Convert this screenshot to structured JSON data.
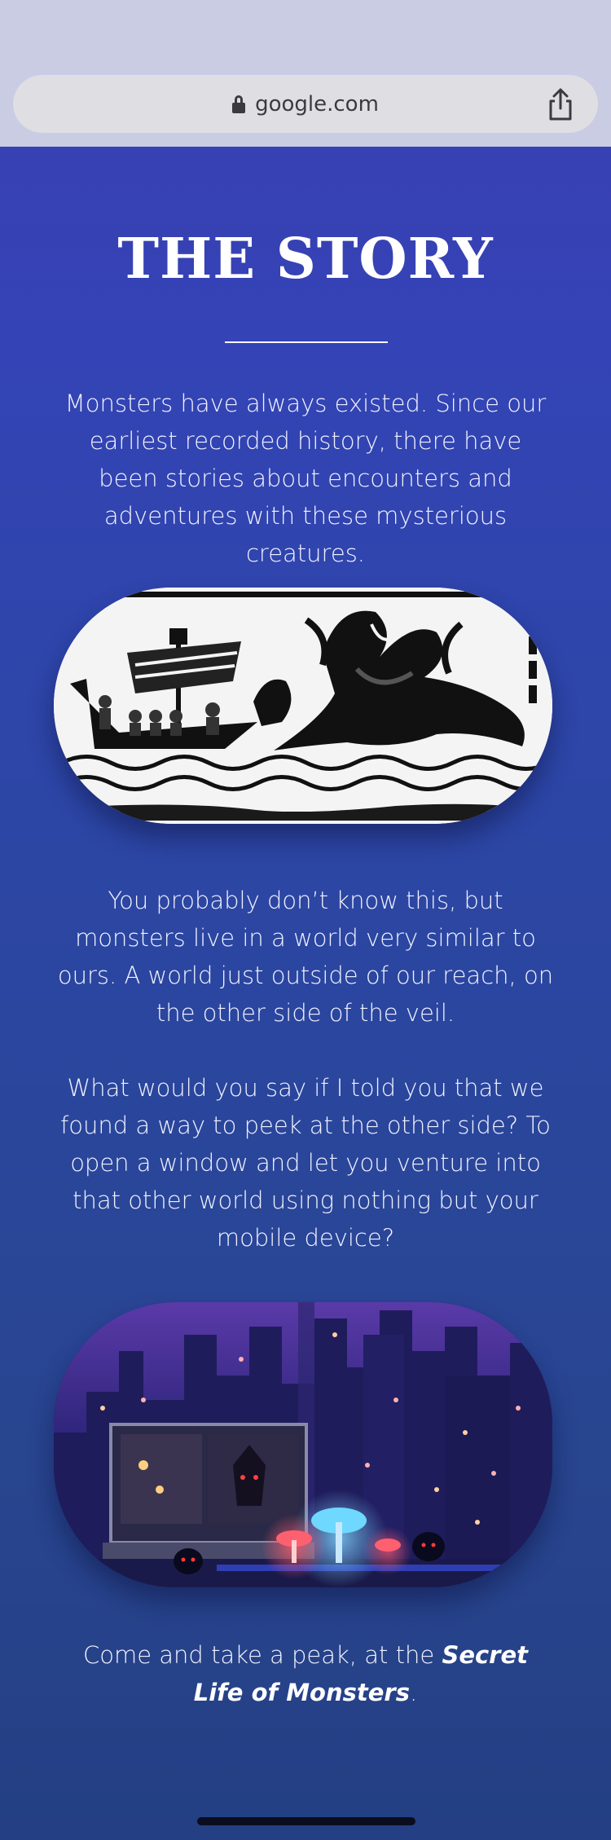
{
  "browser": {
    "url": "google.com"
  },
  "story": {
    "title": "THE STORY",
    "paragraph_1": "Monsters have always existed. Since our earliest recorded history, there have been stories about encounters and adventures with these mysterious creatures.",
    "paragraph_2": "You probably don’t know this, but monsters live in a world very similar to ours. A world just outside of our reach, on the other side of the veil.",
    "paragraph_3": "What would you say if I told you that we found a way to peek at the other side? To open a window and let you venture into that other world using nothing but your mobile device?",
    "paragraph_4_prefix": "Come and take a peak, at the ",
    "paragraph_4_emphasis": "Secret Life of Monsters",
    "paragraph_4_suffix": "."
  },
  "colors": {
    "chrome": "#c9cce3",
    "url_bar": "#dedee3",
    "background_top": "#3c3fb0",
    "background_bottom": "#243f83"
  },
  "icons": [
    "lock-icon",
    "share-icon"
  ]
}
